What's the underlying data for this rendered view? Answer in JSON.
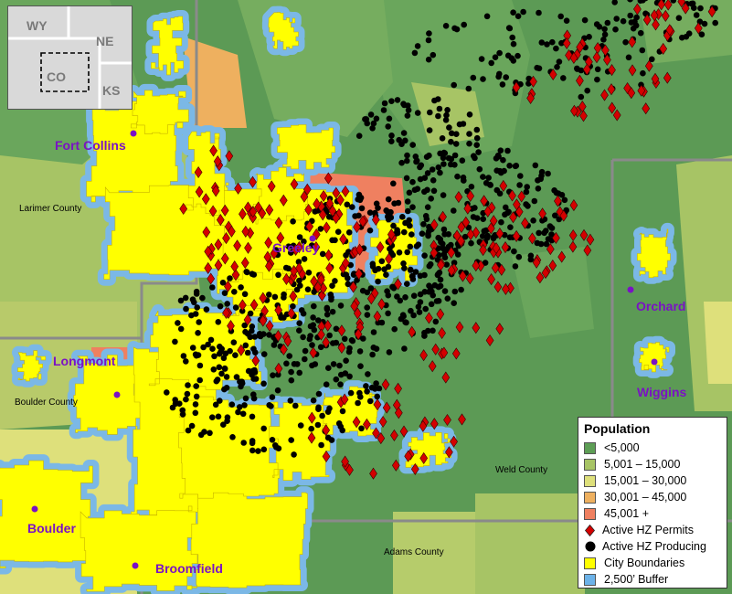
{
  "inset": {
    "states": [
      "WY",
      "NE",
      "CO",
      "KS"
    ]
  },
  "cities": [
    {
      "name": "Fort Collins"
    },
    {
      "name": "Greeley"
    },
    {
      "name": "Longmont"
    },
    {
      "name": "Boulder"
    },
    {
      "name": "Broomfield"
    },
    {
      "name": "Orchard"
    },
    {
      "name": "Wiggins"
    }
  ],
  "counties": [
    {
      "name": "Larimer County"
    },
    {
      "name": "Boulder County"
    },
    {
      "name": "Weld County"
    },
    {
      "name": "Adams County"
    }
  ],
  "legend": {
    "title": "Population",
    "items": [
      {
        "label": "<5,000",
        "color": "#5d9e55",
        "kind": "swatch"
      },
      {
        "label": "5,001 – 15,000",
        "color": "#a7c465",
        "kind": "swatch"
      },
      {
        "label": "15,001 – 30,000",
        "color": "#dee07b",
        "kind": "swatch"
      },
      {
        "label": "30,001 – 45,000",
        "color": "#eeb05f",
        "kind": "swatch"
      },
      {
        "label": "45,001 +",
        "color": "#ef8060",
        "kind": "swatch"
      },
      {
        "label": "Active HZ Permits",
        "color": "#d40000",
        "kind": "diamond"
      },
      {
        "label": "Active HZ Producing",
        "color": "#000000",
        "kind": "dot"
      },
      {
        "label": "City Boundaries",
        "color": "#ffff00",
        "kind": "swatch"
      },
      {
        "label": "2,500’ Buffer",
        "color": "#6cb2e8",
        "kind": "swatch"
      }
    ]
  },
  "colors": {
    "city_label": "#7a12c4",
    "county_label": "#000000",
    "buffer": "#7bb8e6",
    "city": "#ffff00"
  }
}
